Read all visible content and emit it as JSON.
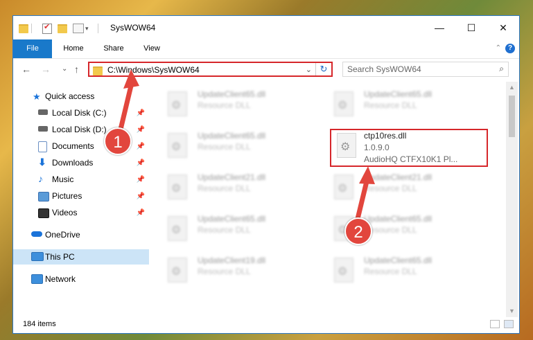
{
  "window": {
    "title": "SysWOW64",
    "quick_access_toolbar": [
      "folder-icon",
      "properties-icon",
      "new-folder-icon",
      "customize-icon"
    ],
    "controls": {
      "minimize": "—",
      "maximize": "☐",
      "close": "✕"
    }
  },
  "ribbon": {
    "tabs": [
      "File",
      "Home",
      "Share",
      "View"
    ],
    "help": "?",
    "collapse": "⌃"
  },
  "navigation": {
    "back": "←",
    "forward": "→",
    "recent": "⌄",
    "up": "↑",
    "address": "C:\\Windows\\SysWOW64",
    "address_dropdown": "⌄",
    "refresh": "↻",
    "search_placeholder": "Search SysWOW64",
    "search_icon": "⌕"
  },
  "sidebar": {
    "items": [
      {
        "label": "Quick access",
        "icon": "star-icon",
        "pinned": false
      },
      {
        "label": "Local Disk (C:)",
        "icon": "drive-icon",
        "pinned": true
      },
      {
        "label": "Local Disk (D:)",
        "icon": "drive-icon",
        "pinned": true
      },
      {
        "label": "Documents",
        "icon": "documents-icon",
        "pinned": true
      },
      {
        "label": "Downloads",
        "icon": "downloads-icon",
        "pinned": true
      },
      {
        "label": "Music",
        "icon": "music-icon",
        "pinned": true
      },
      {
        "label": "Pictures",
        "icon": "pictures-icon",
        "pinned": true
      },
      {
        "label": "Videos",
        "icon": "videos-icon",
        "pinned": true
      },
      {
        "label": "OneDrive",
        "icon": "cloud-icon",
        "pinned": false
      },
      {
        "label": "This PC",
        "icon": "computer-icon",
        "pinned": false,
        "selected": true
      },
      {
        "label": "Network",
        "icon": "network-icon",
        "pinned": false
      }
    ],
    "pin_glyph": "📌"
  },
  "files": {
    "left": [
      {
        "name": "UpdateClient65.dll",
        "desc": "Resource DLL"
      },
      {
        "name": "UpdateClient65.dll",
        "desc": "Resource DLL"
      },
      {
        "name": "UpdateClient21.dll",
        "desc": "Resource DLL"
      },
      {
        "name": "UpdateClient65.dll",
        "desc": "Resource DLL"
      },
      {
        "name": "UpdateClient19.dll",
        "desc": "Resource DLL"
      }
    ],
    "right": [
      {
        "name": "UpdateClient65.dll",
        "desc": "Resource DLL"
      },
      {
        "name": "ctp10res.dll",
        "version": "1.0.9.0",
        "desc": "AudioHQ CTFX10K1 Pl...",
        "selected": true
      },
      {
        "name": "UpdateClient21.dll",
        "desc": "Resource DLL"
      },
      {
        "name": "UpdateClient65.dll",
        "desc": "Resource DLL"
      },
      {
        "name": "UpdateClient65.dll",
        "desc": "Resource DLL"
      }
    ]
  },
  "status": {
    "item_count": "184 items"
  },
  "annotations": {
    "badge1": "1",
    "badge2": "2"
  },
  "colors": {
    "accent": "#1979ca",
    "highlight_border": "#d6262a",
    "badge": "#e2463d"
  }
}
